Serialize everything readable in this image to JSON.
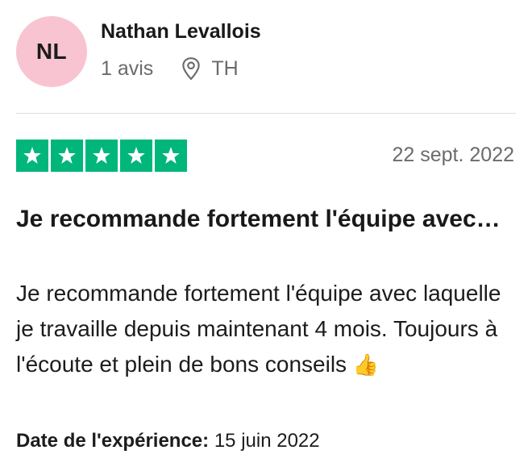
{
  "reviewer": {
    "initials": "NL",
    "name": "Nathan Levallois",
    "review_count": "1 avis",
    "country": "TH",
    "avatar_color": "#f8c4d2"
  },
  "review": {
    "rating": 5,
    "max_rating": 5,
    "star_color": "#00b67a",
    "date": "22 sept. 2022",
    "title": "Je recommande fortement l'équipe avec…",
    "body": "Je recommande fortement l'équipe avec laquelle je travaille depuis maintenant 4 mois. Toujours à l'écoute et plein de bons conseils",
    "body_emoji": "👍",
    "experience_label": "Date de l'expérience:",
    "experience_date": "15 juin 2022"
  },
  "icons": {
    "location": "location-pin-icon",
    "star": "star-icon"
  }
}
